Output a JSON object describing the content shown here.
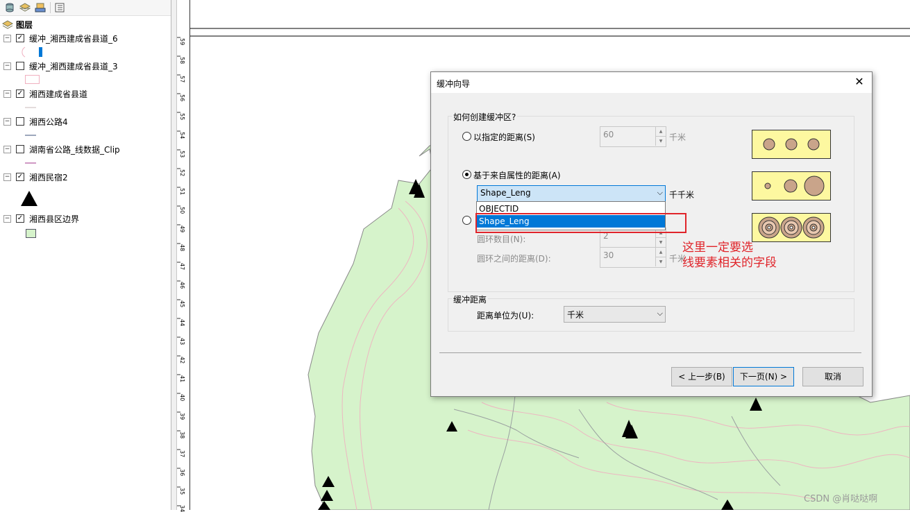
{
  "toc": {
    "root_label": "图层",
    "layers": [
      {
        "name": "缓冲_湘西建成省县道_6",
        "checked": true
      },
      {
        "name": "缓冲_湘西建成省县道_3",
        "checked": false
      },
      {
        "name": "湘西建成省县道",
        "checked": true
      },
      {
        "name": "湘西公路4",
        "checked": false
      },
      {
        "name": "湖南省公路_线数据_Clip",
        "checked": false
      },
      {
        "name": "湘西民宿2",
        "checked": true
      },
      {
        "name": "湘西县区边界",
        "checked": true
      }
    ],
    "toolbar_icons": [
      "database-icon",
      "layers-icon",
      "source-icon",
      "selection-list-icon"
    ]
  },
  "ruler": {
    "ticks": [
      "59",
      "58",
      "57",
      "56",
      "55",
      "54",
      "53",
      "52",
      "51",
      "50",
      "49",
      "48",
      "47",
      "46",
      "45",
      "44",
      "43",
      "42",
      "41",
      "40",
      "39",
      "38",
      "37",
      "36",
      "35",
      "34"
    ]
  },
  "dialog": {
    "title": "缓冲向导",
    "close_glyph": "✕",
    "group1_label": "如何创建缓冲区?",
    "radio_fixed_label": "以指定的距离(S)",
    "fixed_value": "60",
    "fixed_unit": "千米",
    "radio_attr_label": "基于来自属性的距离(A)",
    "field_value": "Shape_Leng",
    "field_unit": "千千米",
    "dropdown_options": [
      "OBJECTID",
      "Shape_Leng"
    ],
    "dropdown_selected": "Shape_Leng",
    "rings_count_label": "圆环数目(N):",
    "rings_count_value": "2",
    "rings_distance_label": "圆环之间的距离(D):",
    "rings_distance_value": "30",
    "rings_distance_unit": "千米",
    "group2_label": "缓冲距离",
    "distance_unit_label": "距离单位为(U):",
    "distance_unit_value": "千米",
    "back_button": "< 上一步(B)",
    "next_button": "下一页(N) >",
    "cancel_button": "取消"
  },
  "annotation": {
    "text": "这里一定要选\n线要素相关的字段",
    "color": "#e0242a"
  },
  "watermark": "CSDN @肖哒哒啊",
  "colors": {
    "region_fill": "#d6f3cb",
    "preview_fill": "#fdf8a0",
    "preview_circle": "#c9a48a",
    "selection_blue": "#0078d7",
    "contour_pink": "#f0b0c0"
  }
}
